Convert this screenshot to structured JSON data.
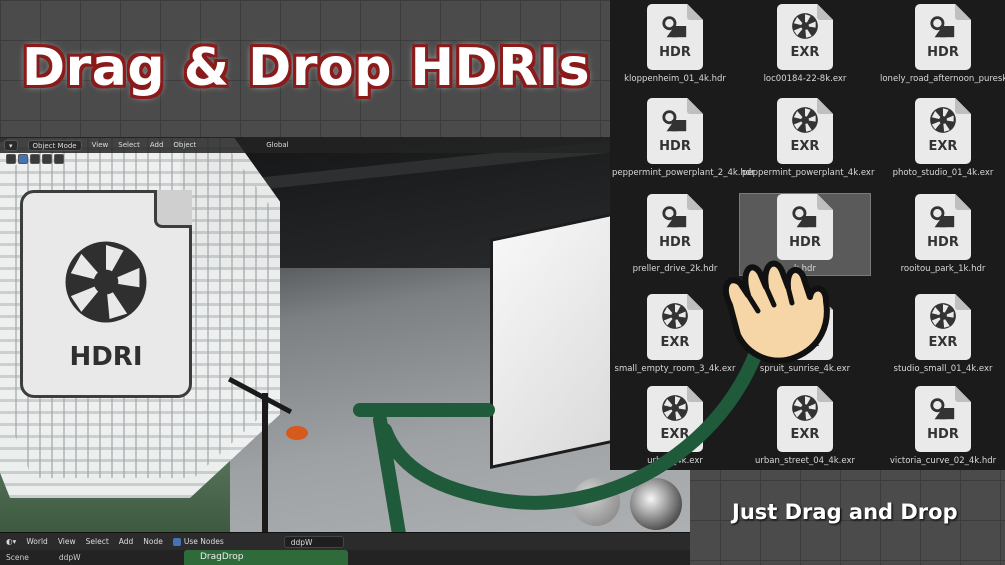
{
  "headline": "Drag & Drop HDRIs",
  "caption": "Just Drag and Drop",
  "viewport_header": {
    "mode": "Object Mode",
    "menu": [
      "View",
      "Select",
      "Add",
      "Object"
    ],
    "orientation": "Global"
  },
  "hdri_icon": {
    "label": "HDRI",
    "icon": "aperture-icon"
  },
  "files": [
    {
      "ext": "HDR",
      "name": "kloppenheim_01_4k.hdr",
      "icon": "hdr-file-icon"
    },
    {
      "ext": "EXR",
      "name": "loc00184-22-8k.exr",
      "icon": "exr-file-icon"
    },
    {
      "ext": "HDR",
      "name": "lonely_road_afternoon_puresky_4k.hdr",
      "icon": "hdr-file-icon"
    },
    {
      "ext": "HDR",
      "name": "peppermint_powerplant_2_4k.hdr",
      "icon": "hdr-file-icon"
    },
    {
      "ext": "EXR",
      "name": "peppermint_powerplant_4k.exr",
      "icon": "exr-file-icon"
    },
    {
      "ext": "EXR",
      "name": "photo_studio_01_4k.exr",
      "icon": "exr-file-icon"
    },
    {
      "ext": "HDR",
      "name": "preller_drive_2k.hdr",
      "icon": "hdr-file-icon"
    },
    {
      "ext": "HDR",
      "name": "k.hdr",
      "icon": "hdr-file-icon"
    },
    {
      "ext": "HDR",
      "name": "rooitou_park_1k.hdr",
      "icon": "hdr-file-icon"
    },
    {
      "ext": "EXR",
      "name": "small_empty_room_3_4k.exr",
      "icon": "exr-file-icon"
    },
    {
      "ext": "EXR",
      "name": "spruit_sunrise_4k.exr",
      "icon": "exr-file-icon"
    },
    {
      "ext": "EXR",
      "name": "studio_small_01_4k.exr",
      "icon": "exr-file-icon"
    },
    {
      "ext": "EXR",
      "name": "urban_4k.exr",
      "icon": "exr-file-icon"
    },
    {
      "ext": "EXR",
      "name": "urban_street_04_4k.exr",
      "icon": "exr-file-icon"
    },
    {
      "ext": "HDR",
      "name": "victoria_curve_02_4k.hdr",
      "icon": "hdr-file-icon"
    }
  ],
  "node_header": {
    "world": "World",
    "menu": [
      "View",
      "Select",
      "Add",
      "Node"
    ],
    "use_nodes": "Use Nodes",
    "world_name": "ddpW"
  },
  "status_bar": {
    "scene": "Scene",
    "world_name": "ddpW",
    "node_group": "DragDrop"
  },
  "colors": {
    "headline_outline": "#8a1b1b",
    "arrow": "#1f5a3a",
    "selected_file": "#5a5a5a"
  }
}
